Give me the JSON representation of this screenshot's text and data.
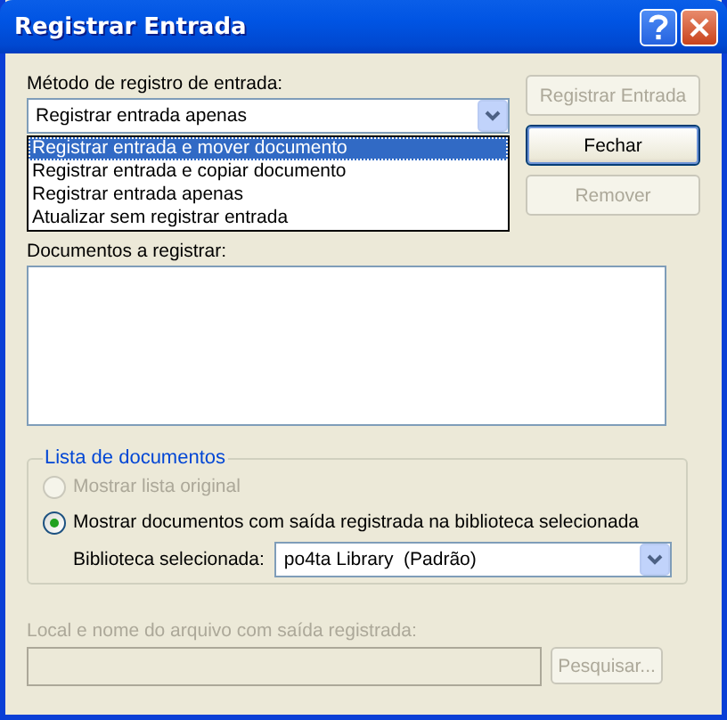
{
  "window": {
    "title": "Registrar Entrada"
  },
  "method": {
    "label": "Método de registro de entrada:",
    "value": "Registrar entrada apenas",
    "expanded": true,
    "options": [
      {
        "label": "Registrar entrada e mover documento",
        "highlighted": true
      },
      {
        "label": "Registrar entrada e copiar documento",
        "highlighted": false
      },
      {
        "label": "Registrar entrada apenas",
        "highlighted": false
      },
      {
        "label": "Atualizar sem registrar entrada",
        "highlighted": false
      }
    ]
  },
  "buttons": [
    {
      "label": "Registrar Entrada",
      "disabled": true,
      "default": false
    },
    {
      "label": "Fechar",
      "disabled": false,
      "default": true
    },
    {
      "label": "Remover",
      "disabled": true,
      "default": false
    }
  ],
  "documents": {
    "label": "Documentos a registrar:"
  },
  "document_list": {
    "title": "Lista de documentos",
    "options": [
      {
        "label": "Mostrar lista original",
        "selected": false,
        "disabled": true
      },
      {
        "label": "Mostrar documentos com saída registrada na biblioteca selecionada",
        "selected": true,
        "disabled": false
      }
    ],
    "library": {
      "label": "Biblioteca selecionada:",
      "value": "po4ta Library  (Padrão)"
    }
  },
  "file": {
    "label": "Local e nome do arquivo com saída registrada:",
    "disabled": true,
    "button": "Pesquisar..."
  }
}
